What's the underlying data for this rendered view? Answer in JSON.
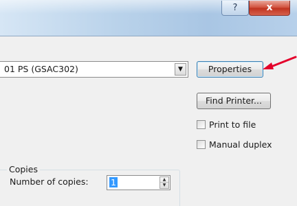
{
  "titlebar": {
    "help_label": "?",
    "close_label": "x"
  },
  "printer": {
    "name": "01 PS (GSAC302)"
  },
  "buttons": {
    "properties": "Properties",
    "find_printer": "Find Printer..."
  },
  "options": {
    "print_to_file": "Print to file",
    "manual_duplex": "Manual duplex"
  },
  "copies": {
    "group_label": "Copies",
    "number_label": "Number of copies:",
    "number_value": "1"
  },
  "colors": {
    "annotation_arrow": "#e4002b",
    "selection_highlight": "#3399ff",
    "close_button": "#c8412d"
  }
}
